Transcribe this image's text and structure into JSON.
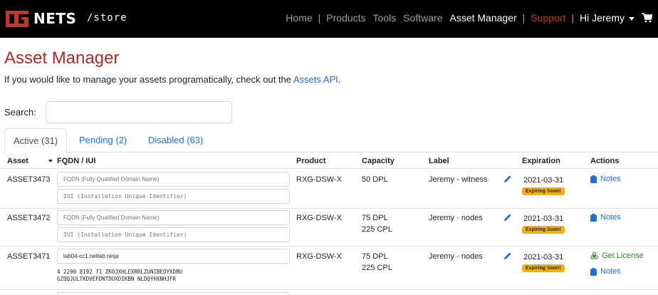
{
  "navbar": {
    "logo_text": "NETS",
    "store_path": "/store",
    "links": [
      {
        "label": "Home"
      },
      {
        "label": "Products"
      },
      {
        "label": "Tools"
      },
      {
        "label": "Software"
      },
      {
        "label": "Asset Manager"
      },
      {
        "label": "Support"
      }
    ],
    "user_label": "Hi Jeremy",
    "accent_color": "#c0392b"
  },
  "page": {
    "title": "Asset Manager",
    "intro_text": "If you would like to manage your assets programatically, check out the ",
    "intro_link": "Assets API",
    "intro_suffix": "."
  },
  "search": {
    "label": "Search:",
    "value": ""
  },
  "tabs": [
    {
      "label": "Active (31)",
      "active": true
    },
    {
      "label": "Pending (2)",
      "active": false
    },
    {
      "label": "Disabled (63)",
      "active": false
    }
  ],
  "table": {
    "headers": {
      "asset": "Asset",
      "fqdn_iui": "FQDN / IUI",
      "product": "Product",
      "capacity": "Capacity",
      "label": "Label",
      "expiration": "Expiration",
      "actions": "Actions"
    },
    "fqdn_placeholder": "FQDN (Fully Qualified Domain Name)",
    "iui_placeholder": "IUI (Installation Unique Identifier)",
    "rows": [
      {
        "asset": "ASSET3473",
        "fqdn": "",
        "iui": "",
        "product": "RXG-DSW-X",
        "capacity": [
          "50 DPL"
        ],
        "label": "Jeremy - witness",
        "expiration": "2021-03-31",
        "badge": "Expiring Soon!",
        "actions": [
          "Notes"
        ]
      },
      {
        "asset": "ASSET3472",
        "fqdn": "",
        "iui": "",
        "product": "RXG-DSW-X",
        "capacity": [
          "75 DPL",
          "225 CPL"
        ],
        "label": "Jeremy - nodes",
        "expiration": "2021-03-31",
        "badge": "Expiring Soon!",
        "actions": [
          "Notes"
        ]
      },
      {
        "asset": "ASSET3471",
        "fqdn": "lab04-cc1.netlab.ninja",
        "iui_lines": [
          "4 2290 8192 71 ZKOJXHLEXRRLZUNIBEOYXDBU",
          "GZQQJULTKDVEFDNTDUXDIKBN NLDQYHXNHJFR"
        ],
        "product": "RXG-DSW-X",
        "capacity": [
          "75 DPL",
          "225 CPL"
        ],
        "label": "Jeremy - nodes",
        "expiration": "2021-03-31",
        "badge": "Expiring Soon!",
        "actions": [
          "Get License",
          "Notes"
        ]
      }
    ]
  },
  "colors": {
    "title": "#b02a2a",
    "link": "#1f6fd1",
    "badge": "#f0b400",
    "license": "#2e8b2e"
  }
}
